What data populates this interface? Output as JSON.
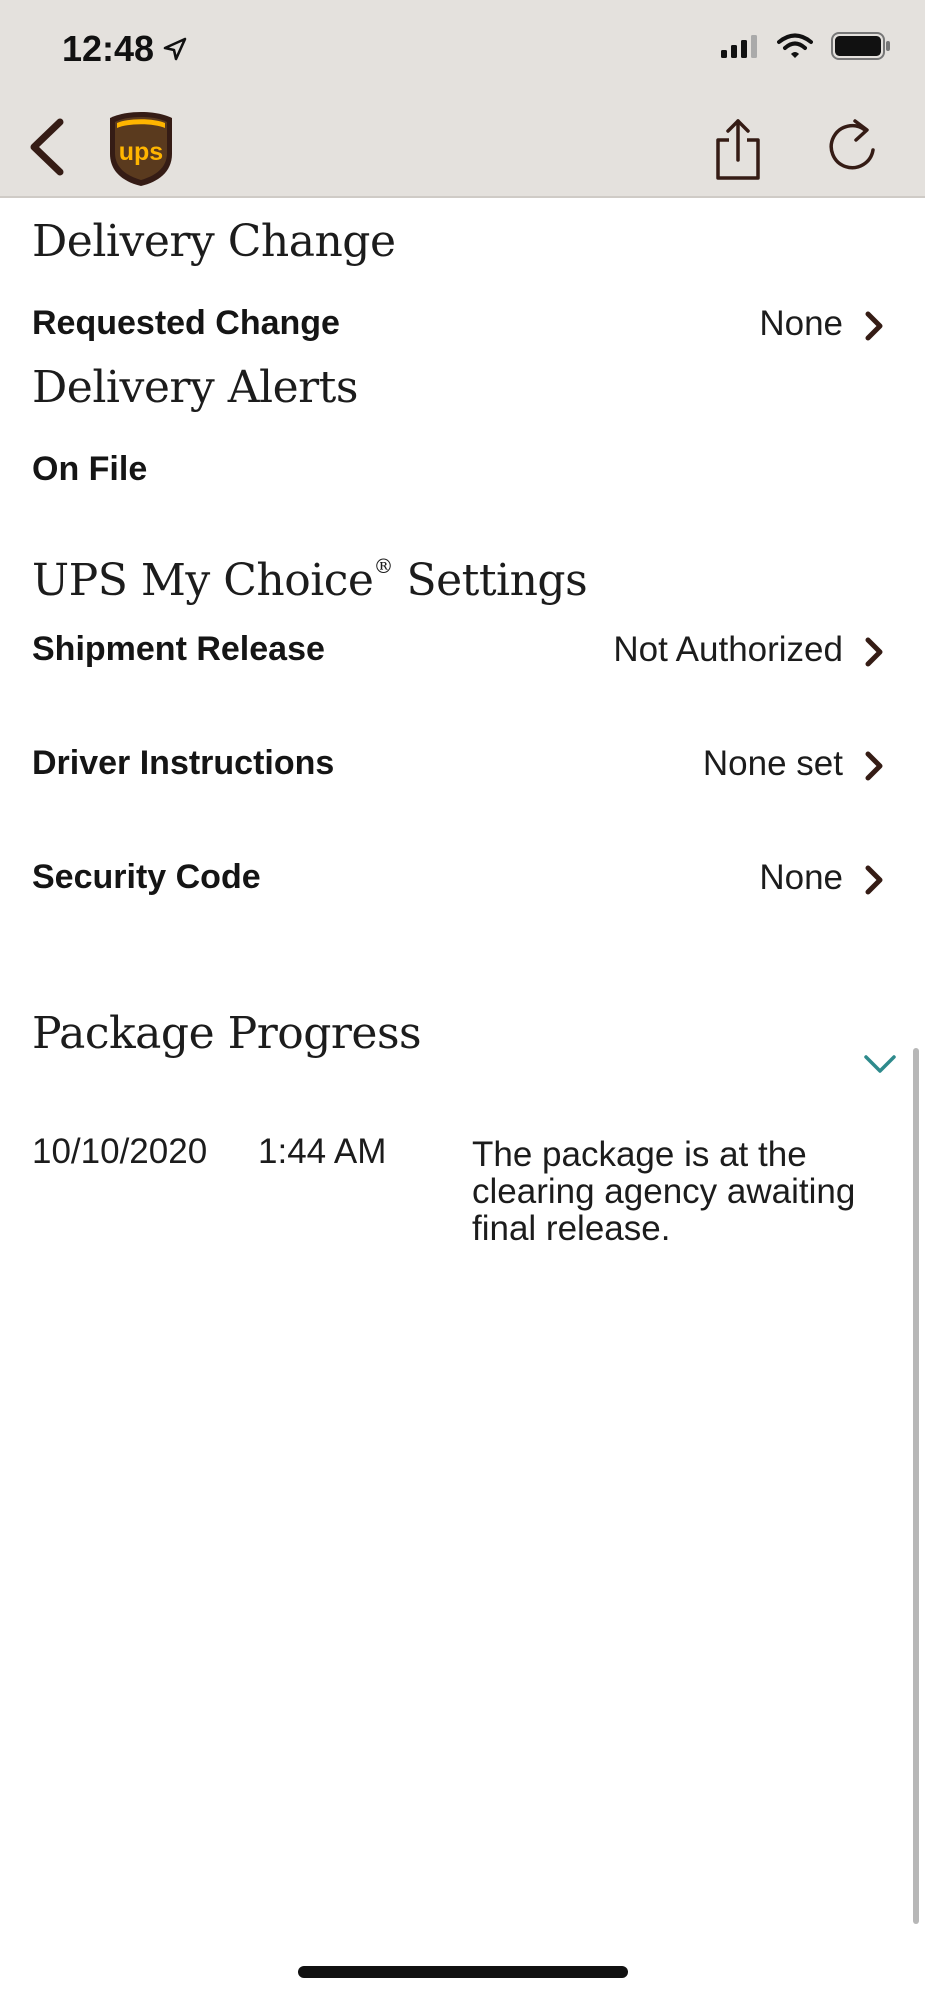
{
  "status_bar": {
    "time": "12:48"
  },
  "header": {
    "logo_text": "ups",
    "back_icon": "chevron-left-icon",
    "share_icon": "share-icon",
    "refresh_icon": "refresh-icon"
  },
  "delivery_change": {
    "title": "Delivery Change",
    "rows": [
      {
        "label": "Requested Change",
        "value": "None"
      }
    ]
  },
  "delivery_alerts": {
    "title": "Delivery Alerts",
    "on_file_label": "On File"
  },
  "my_choice": {
    "title_main": "UPS My Choice",
    "title_reg": "®",
    "title_tail": " Settings",
    "rows": [
      {
        "label": "Shipment Release",
        "value": "Not Authorized"
      },
      {
        "label": "Driver Instructions",
        "value": "None set"
      },
      {
        "label": "Security Code",
        "value": "None"
      }
    ]
  },
  "package_progress": {
    "title": "Package Progress",
    "events": [
      {
        "date": "10/10/2020",
        "time": "1:44 AM",
        "description": "The package is at the clearing agency awaiting final release."
      }
    ]
  },
  "colors": {
    "header_bg": "#e4e1dd",
    "brand_brown": "#351c15",
    "ups_gold": "#ffb500",
    "accent_teal": "#2e8a8c"
  }
}
